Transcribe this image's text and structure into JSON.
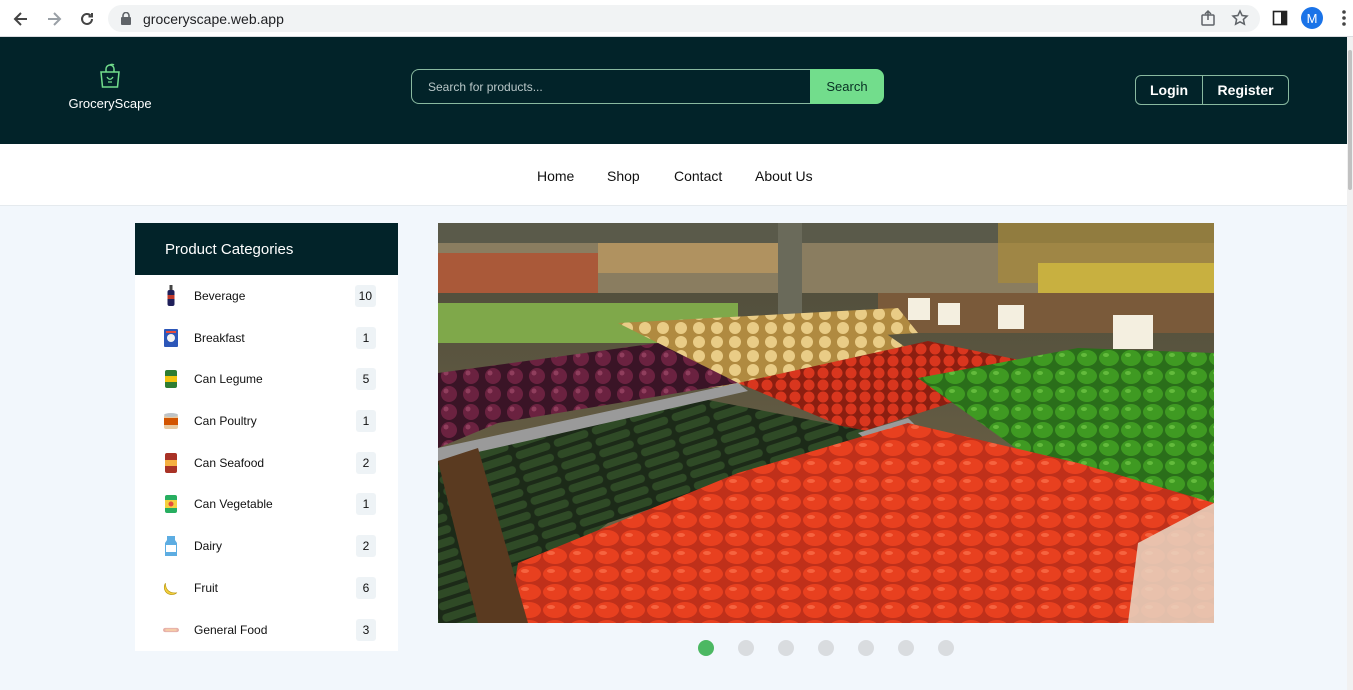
{
  "browser": {
    "url": "groceryscape.web.app",
    "profile_initial": "M"
  },
  "header": {
    "brand": "GroceryScape",
    "search_placeholder": "Search for products...",
    "search_button": "Search",
    "login": "Login",
    "register": "Register"
  },
  "nav": {
    "items": [
      "Home",
      "Shop",
      "Contact",
      "About Us"
    ]
  },
  "categories": {
    "title": "Product Categories",
    "items": [
      {
        "label": "Beverage",
        "count": "10",
        "icon": "bottle-icon"
      },
      {
        "label": "Breakfast",
        "count": "1",
        "icon": "cereal-box-icon"
      },
      {
        "label": "Can Legume",
        "count": "5",
        "icon": "can-icon"
      },
      {
        "label": "Can Poultry",
        "count": "1",
        "icon": "can-icon"
      },
      {
        "label": "Can Seafood",
        "count": "2",
        "icon": "can-icon"
      },
      {
        "label": "Can Vegetable",
        "count": "1",
        "icon": "can-icon"
      },
      {
        "label": "Dairy",
        "count": "2",
        "icon": "milk-icon"
      },
      {
        "label": "Fruit",
        "count": "6",
        "icon": "banana-icon"
      },
      {
        "label": "General Food",
        "count": "3",
        "icon": "food-icon"
      }
    ]
  },
  "carousel": {
    "slides": 7,
    "active": 0
  },
  "colors": {
    "header_bg": "#022329",
    "accent": "#72dd8c",
    "active_dot": "#4cb862",
    "page_bg": "#f2f7fc"
  }
}
